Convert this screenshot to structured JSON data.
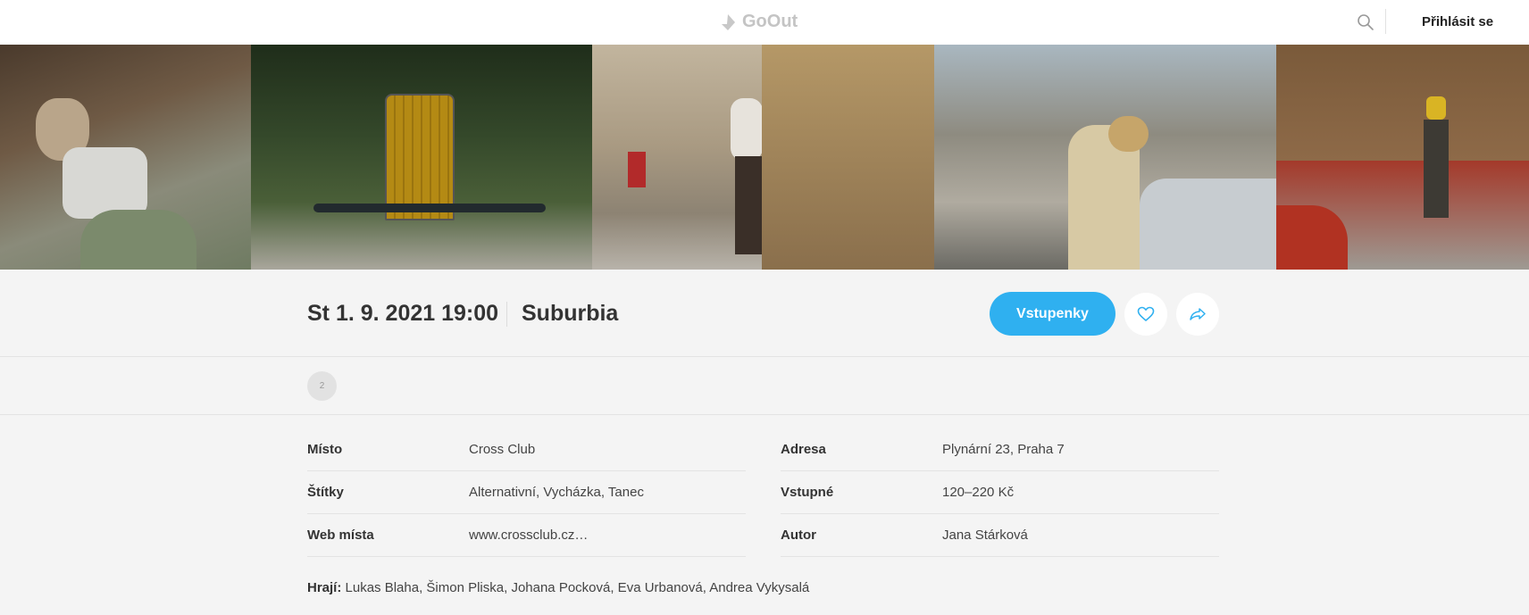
{
  "header": {
    "logo_text": "GoOut",
    "login_label": "Přihlásit se",
    "icons": [
      "goout-logo-icon",
      "search-icon"
    ]
  },
  "gallery": {
    "photo_count": 5
  },
  "event": {
    "datetime": "St 1. 9. 2021 19:00",
    "title": "Suburbia",
    "tickets_label": "Vstupenky",
    "accent_color": "#2fb0f0",
    "icons": [
      "heart-icon",
      "share-icon"
    ]
  },
  "tags": {
    "count_badge": "2"
  },
  "details": {
    "left": [
      {
        "label": "Místo",
        "value": "Cross Club"
      },
      {
        "label": "Štítky",
        "value": "Alternativní, Vycházka, Tanec"
      },
      {
        "label": "Web místa",
        "value": "www.crossclub.cz…"
      }
    ],
    "right": [
      {
        "label": "Adresa",
        "value": "Plynární 23, Praha 7"
      },
      {
        "label": "Vstupné",
        "value": "120–220 Kč"
      },
      {
        "label": "Autor",
        "value": "Jana Stárková"
      }
    ]
  },
  "performers": {
    "label": "Hrají:",
    "names": "Lukas Blaha, Šimon Pliska, Johana Pocková, Eva Urbanová, Andrea Vykysalá"
  }
}
